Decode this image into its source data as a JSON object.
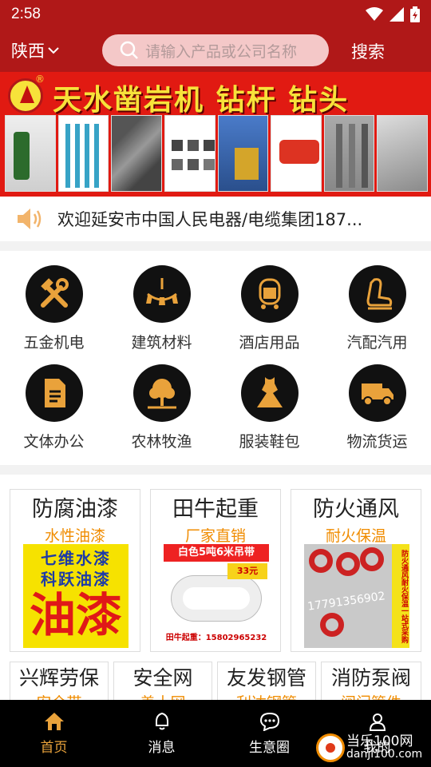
{
  "status_bar": {
    "time": "2:58"
  },
  "header": {
    "region": "陕西",
    "search_placeholder": "请输入产品或公司名称",
    "search_button": "搜索"
  },
  "banner": {
    "title": "天水凿岩机 钻杆 钻头",
    "reg_mark": "®"
  },
  "notice": {
    "text": "欢迎延安市中国人民电器/电缆集团187..."
  },
  "categories": [
    {
      "label": "五金机电",
      "icon": "tools-icon"
    },
    {
      "label": "建筑材料",
      "icon": "chandelier-icon"
    },
    {
      "label": "酒店用品",
      "icon": "luggage-cart-icon"
    },
    {
      "label": "汽配汽用",
      "icon": "car-seat-icon"
    },
    {
      "label": "文体办公",
      "icon": "document-icon"
    },
    {
      "label": "农林牧渔",
      "icon": "tree-icon"
    },
    {
      "label": "服装鞋包",
      "icon": "dress-icon"
    },
    {
      "label": "物流货运",
      "icon": "truck-icon"
    }
  ],
  "promos": [
    {
      "title": "防腐油漆",
      "subtitle": "水性油漆",
      "img_line1": "七维水漆",
      "img_line2": "科跃油漆",
      "img_big": "油漆"
    },
    {
      "title": "田牛起重",
      "subtitle": "厂家直销",
      "img_bar": "白色5吨6米吊带",
      "img_price": "33元",
      "img_phone": "田牛起重：15802965232"
    },
    {
      "title": "防火通风",
      "subtitle": "耐火保温",
      "img_phone": "17791356902",
      "img_side": "防火通风耐火保温一站式采购"
    }
  ],
  "small_cards": [
    {
      "title": "兴辉劳保",
      "subtitle": "安全带"
    },
    {
      "title": "安全网",
      "subtitle": "盖土网"
    },
    {
      "title": "友发钢管",
      "subtitle": "利达钢管"
    },
    {
      "title": "消防泵阀",
      "subtitle": "阀门管件"
    }
  ],
  "nav": [
    {
      "label": "首页",
      "icon": "home-icon",
      "active": true
    },
    {
      "label": "消息",
      "icon": "bell-icon",
      "active": false
    },
    {
      "label": "生意圈",
      "icon": "chat-icon",
      "active": false
    },
    {
      "label": "我的",
      "icon": "user-icon",
      "active": false
    }
  ],
  "watermark": {
    "line1": "当乐100网",
    "line2": "danji100.com"
  },
  "colors": {
    "header_red": "#b01818",
    "accent_orange": "#f08c00",
    "nav_active": "#e9a23b"
  }
}
